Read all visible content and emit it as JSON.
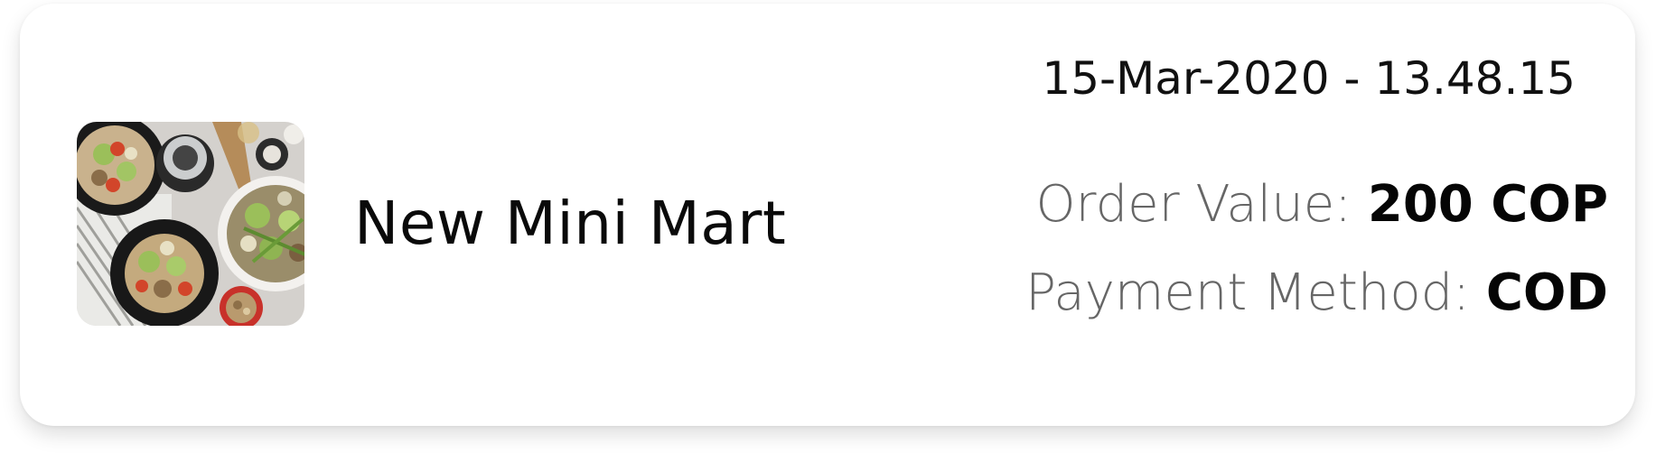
{
  "order": {
    "store_name": "New Mini Mart",
    "date_time": "15-Mar-2020 - 13.48.15",
    "order_value_label": "Order Value:",
    "order_value": "200 COP",
    "payment_method_label": "Payment Method:",
    "payment_method": "COD"
  },
  "thumbnail": {
    "icon": "food-photo",
    "colors": {
      "table": "#d9d6d2",
      "plate": "#1b1b1b",
      "salad_green": "#9bbf5a",
      "meat": "#9c7b55",
      "tomato": "#d2452a"
    }
  }
}
